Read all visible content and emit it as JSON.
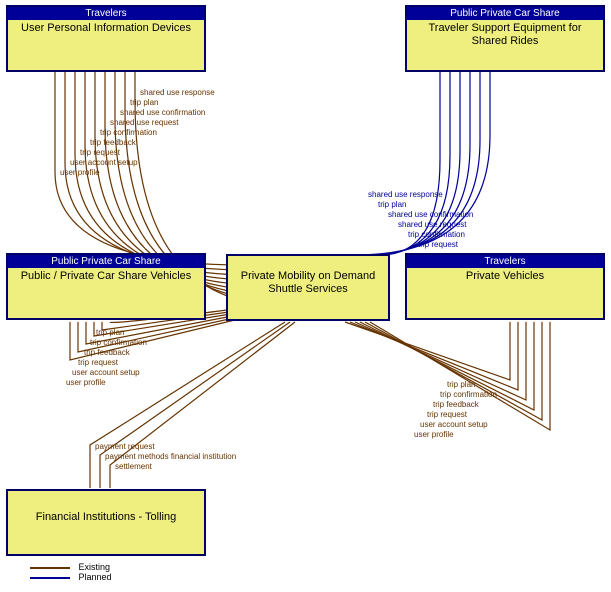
{
  "boxes": {
    "upid": {
      "head": "Travelers",
      "body": "User Personal Information Devices"
    },
    "tse": {
      "head": "Public Private Car Share",
      "body": "Traveler Support Equipment for Shared Rides"
    },
    "ppcsv": {
      "head": "Public Private Car Share",
      "body": "Public / Private Car Share Vehicles"
    },
    "pmds": {
      "head": "",
      "body": "Private Mobility on Demand Shuttle Services"
    },
    "pv": {
      "head": "Travelers",
      "body": "Private Vehicles"
    },
    "fit": {
      "head": "",
      "body": "Financial Institutions - Tolling"
    }
  },
  "flows": {
    "upid": [
      "shared use response",
      "trip plan",
      "shared use confirmation",
      "shared use request",
      "trip confirmation",
      "trip feedback",
      "trip request",
      "user account setup",
      "user profile"
    ],
    "tse": [
      "shared use response",
      "trip plan",
      "shared use confirmation",
      "shared use request",
      "trip confirmation",
      "trip request"
    ],
    "ppcsv": [
      "trip plan",
      "trip confirmation",
      "trip feedback",
      "trip request",
      "user account setup",
      "user profile"
    ],
    "pv": [
      "trip plan",
      "trip confirmation",
      "trip feedback",
      "trip request",
      "user account setup",
      "user profile"
    ],
    "fit": [
      "payment request",
      "payment methods financial institution",
      "settlement"
    ]
  },
  "legend": {
    "existing": "Existing",
    "planned": "Planned"
  },
  "colors": {
    "existing": "#663300",
    "planned": "#000099"
  }
}
